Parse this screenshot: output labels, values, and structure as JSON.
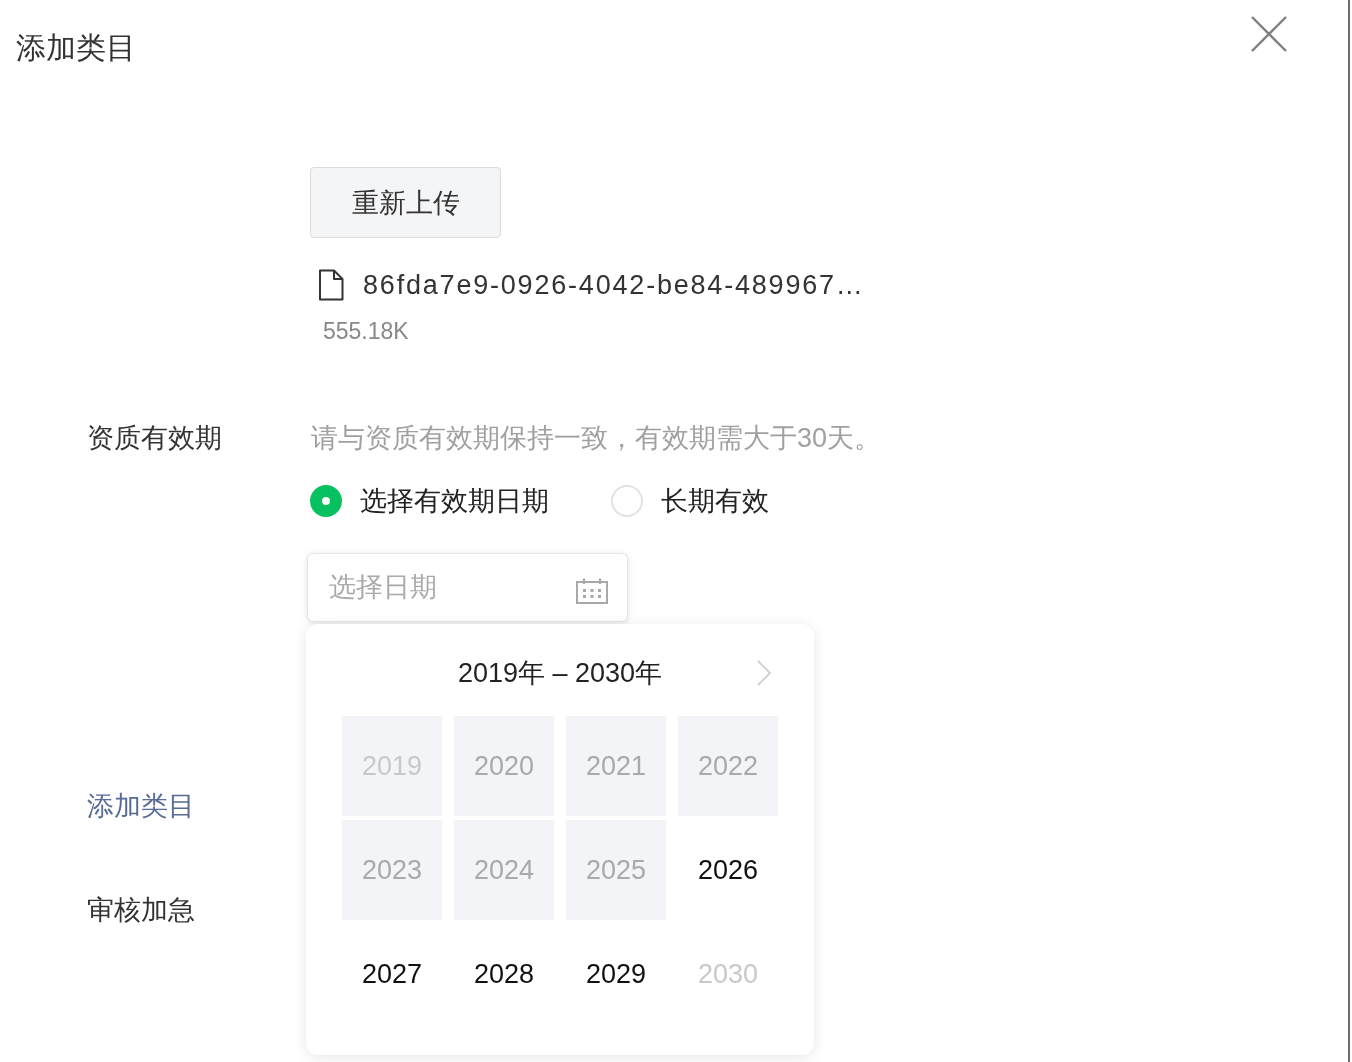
{
  "dialog": {
    "title": "添加类目"
  },
  "upload": {
    "button": "重新上传",
    "file": {
      "name": "86fda7e9-0926-4042-be84-489967…",
      "size": "555.18K"
    }
  },
  "validity": {
    "label": "资质有效期",
    "hint": "请与资质有效期保持一致，有效期需大于30天。",
    "options": [
      {
        "label": "选择有效期日期",
        "selected": true
      },
      {
        "label": "长期有效",
        "selected": false
      }
    ],
    "date_field": {
      "placeholder": "选择日期"
    },
    "year_picker": {
      "range": "2019年 – 2030年",
      "years": [
        {
          "label": "2019",
          "disabled": true,
          "outside_decade": true
        },
        {
          "label": "2020",
          "disabled": true,
          "outside_decade": false
        },
        {
          "label": "2021",
          "disabled": true,
          "outside_decade": false
        },
        {
          "label": "2022",
          "disabled": true,
          "outside_decade": false
        },
        {
          "label": "2023",
          "disabled": true,
          "outside_decade": false
        },
        {
          "label": "2024",
          "disabled": true,
          "outside_decade": false
        },
        {
          "label": "2025",
          "disabled": true,
          "outside_decade": false
        },
        {
          "label": "2026",
          "disabled": false,
          "outside_decade": false
        },
        {
          "label": "2027",
          "disabled": false,
          "outside_decade": false
        },
        {
          "label": "2028",
          "disabled": false,
          "outside_decade": false
        },
        {
          "label": "2029",
          "disabled": false,
          "outside_decade": false
        },
        {
          "label": "2030",
          "disabled": false,
          "outside_decade": true
        }
      ]
    }
  },
  "add_category": {
    "label": "添加类目"
  },
  "expedite": {
    "label": "审核加急"
  }
}
